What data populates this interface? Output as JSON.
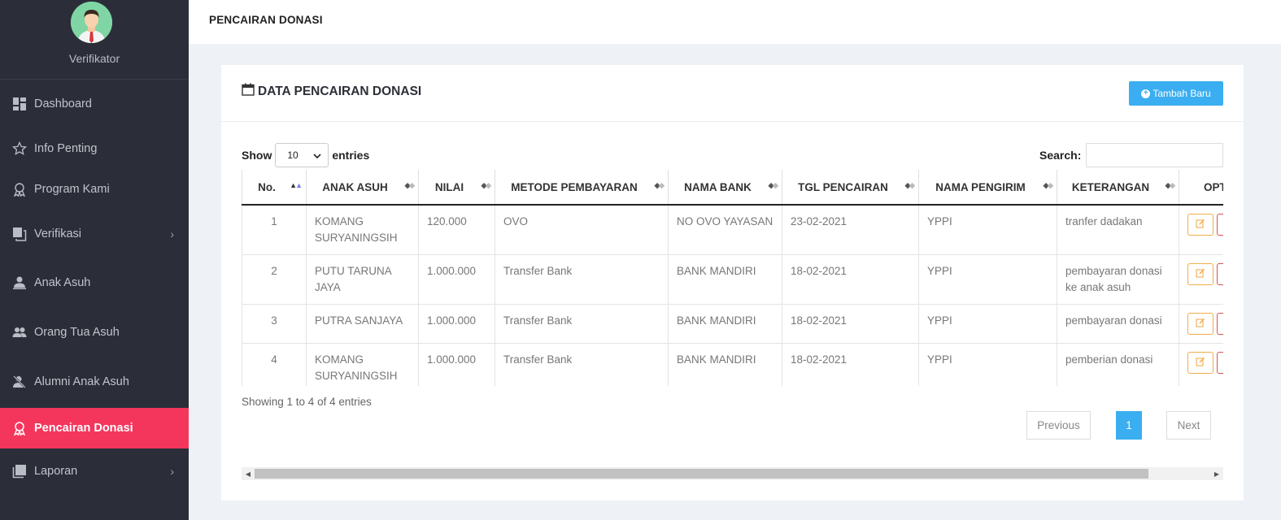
{
  "sidebar": {
    "role": "Verifikator",
    "items": [
      {
        "label": "Dashboard"
      },
      {
        "label": "Info Penting"
      },
      {
        "label": "Program Kami"
      },
      {
        "label": "Verifikasi"
      },
      {
        "label": "Anak Asuh"
      },
      {
        "label": "Orang Tua Asuh"
      },
      {
        "label": "Alumni Anak Asuh"
      },
      {
        "label": "Pencairan Donasi"
      },
      {
        "label": "Laporan"
      }
    ]
  },
  "header": {
    "page_title": "PENCAIRAN DONASI"
  },
  "card": {
    "title": "DATA PENCAIRAN DONASI",
    "add_label": "Tambah Baru"
  },
  "controls": {
    "show_label": "Show",
    "entries_value": "10",
    "entries_label": "entries",
    "search_label": "Search:"
  },
  "table": {
    "headers": [
      "No.",
      "ANAK ASUH",
      "NILAI",
      "METODE PEMBAYARAN",
      "NAMA BANK",
      "TGL PENCAIRAN",
      "NAMA PENGIRIM",
      "KETERANGAN",
      "OPT"
    ],
    "rows": [
      {
        "no": "1",
        "anak": "KOMANG SURYANINGSIH",
        "nilai": "120.000",
        "metode": "OVO",
        "bank": "NO OVO YAYASAN",
        "tgl": "23-02-2021",
        "pengirim": "YPPI",
        "ket": "tranfer dadakan"
      },
      {
        "no": "2",
        "anak": "PUTU TARUNA JAYA",
        "nilai": "1.000.000",
        "metode": "Transfer Bank",
        "bank": "BANK MANDIRI",
        "tgl": "18-02-2021",
        "pengirim": "YPPI",
        "ket": "pembayaran donasi ke anak asuh"
      },
      {
        "no": "3",
        "anak": "PUTRA SANJAYA",
        "nilai": "1.000.000",
        "metode": "Transfer Bank",
        "bank": "BANK MANDIRI",
        "tgl": "18-02-2021",
        "pengirim": "YPPI",
        "ket": "pembayaran donasi"
      },
      {
        "no": "4",
        "anak": "KOMANG SURYANINGSIH",
        "nilai": "1.000.000",
        "metode": "Transfer Bank",
        "bank": "BANK MANDIRI",
        "tgl": "18-02-2021",
        "pengirim": "YPPI",
        "ket": "pemberian donasi"
      }
    ]
  },
  "footer": {
    "info": "Showing 1 to 4 of 4 entries",
    "prev": "Previous",
    "page": "1",
    "next": "Next"
  },
  "colors": {
    "sidebar_bg": "#2b2e38",
    "active": "#f5365c",
    "primary": "#3aaef0"
  }
}
